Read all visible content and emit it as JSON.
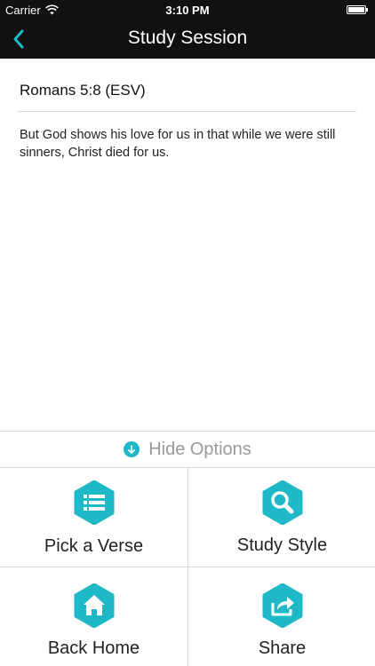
{
  "status_bar": {
    "carrier": "Carrier",
    "time": "3:10 PM"
  },
  "nav": {
    "title": "Study Session",
    "back_icon": "chevron-left-icon"
  },
  "passage": {
    "reference": "Romans 5:8 (ESV)",
    "text": "But God shows his love for us in that while we were still sinners, Christ died for us."
  },
  "options": {
    "toggle_label": "Hide Options",
    "toggle_icon": "arrow-down-circle-icon",
    "tiles": [
      {
        "label": "Pick a Verse",
        "icon": "list-icon"
      },
      {
        "label": "Study Style",
        "icon": "search-icon"
      },
      {
        "label": "Back Home",
        "icon": "home-icon"
      },
      {
        "label": "Share",
        "icon": "share-icon"
      }
    ]
  },
  "colors": {
    "accent": "#1fb8c6",
    "bar": "#111111",
    "divider": "#d9d9d9",
    "muted_text": "#9a9a9a"
  }
}
